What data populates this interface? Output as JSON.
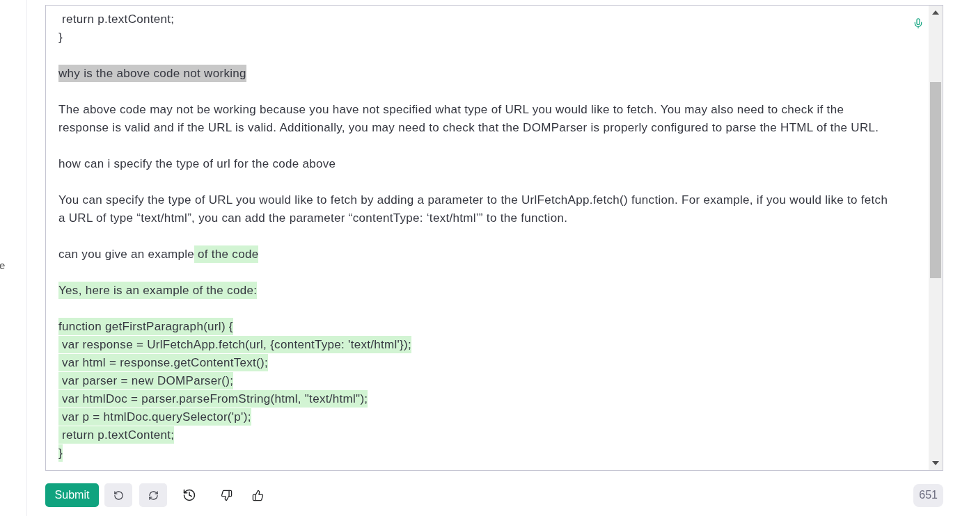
{
  "sidebar": {
    "text": "e"
  },
  "editor": {
    "paragraphs": [
      {
        "lines": [
          {
            "segments": [
              {
                "kind": "plain",
                "text": " return p.textContent;"
              }
            ]
          },
          {
            "segments": [
              {
                "kind": "plain",
                "text": "}"
              }
            ]
          }
        ]
      },
      {
        "lines": [
          {
            "segments": [
              {
                "kind": "highlight",
                "text": "why is the above code not working"
              }
            ]
          }
        ]
      },
      {
        "lines": [
          {
            "segments": [
              {
                "kind": "plain",
                "text": "The above code may not be working because you have not specified what type of URL you would like to fetch. You may also need to check if the\nresponse is valid and if the URL is valid. Additionally, you may need to check that the DOMParser is properly configured to parse the HTML of the URL."
              }
            ]
          }
        ]
      },
      {
        "lines": [
          {
            "segments": [
              {
                "kind": "plain",
                "text": "how can i specify the type of url for the code above"
              }
            ]
          }
        ]
      },
      {
        "lines": [
          {
            "segments": [
              {
                "kind": "plain",
                "text": "You can specify the type of URL you would like to fetch by adding a parameter to the UrlFetchApp.fetch() function. For example, if you would like to fetch\na URL of type “text/html”, you can add the parameter “contentType: ‘text/html’” to the function."
              }
            ]
          }
        ]
      },
      {
        "lines": [
          {
            "segments": [
              {
                "kind": "plain",
                "text": "can you give an example"
              },
              {
                "kind": "completion",
                "text": " of the code"
              }
            ]
          }
        ]
      },
      {
        "lines": [
          {
            "segments": [
              {
                "kind": "completion",
                "text": "Yes, here is an example of the code:"
              }
            ]
          }
        ]
      },
      {
        "lines": [
          {
            "segments": [
              {
                "kind": "completion",
                "text": "function getFirstParagraph(url) {"
              }
            ]
          },
          {
            "segments": [
              {
                "kind": "completion",
                "text": " var response = UrlFetchApp.fetch(url, {contentType: 'text/html'});"
              }
            ]
          },
          {
            "segments": [
              {
                "kind": "completion",
                "text": " var html = response.getContentText();"
              }
            ]
          },
          {
            "segments": [
              {
                "kind": "completion",
                "text": " var parser = new DOMParser();"
              }
            ]
          },
          {
            "segments": [
              {
                "kind": "completion",
                "text": " var htmlDoc = parser.parseFromString(html, \"text/html\");"
              }
            ]
          },
          {
            "segments": [
              {
                "kind": "completion",
                "text": " var p = htmlDoc.querySelector('p');"
              }
            ]
          },
          {
            "segments": [
              {
                "kind": "completion",
                "text": " return p.textContent;"
              }
            ]
          },
          {
            "segments": [
              {
                "kind": "completion",
                "text": "}"
              }
            ]
          }
        ]
      }
    ]
  },
  "toolbar": {
    "buttons": [
      {
        "kind": "submit",
        "label": "Submit"
      },
      {
        "kind": "undo"
      },
      {
        "kind": "regenerate"
      },
      {
        "kind": "history"
      },
      {
        "kind": "thumbs_down"
      },
      {
        "kind": "thumbs_up"
      }
    ],
    "token_count": "651"
  }
}
